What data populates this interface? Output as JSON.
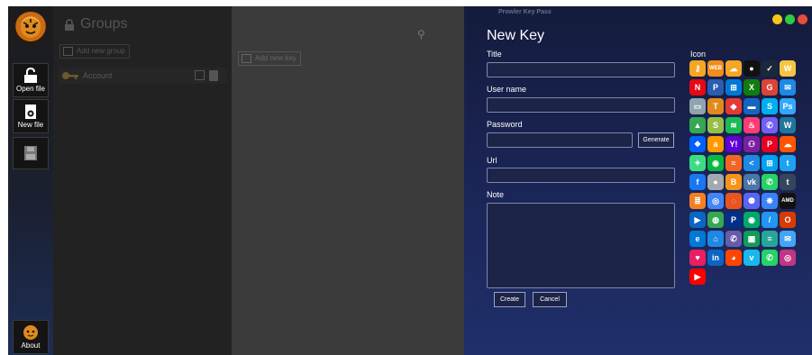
{
  "toolbar": {
    "open_file": "Open file",
    "new_file": "New file",
    "about": "About"
  },
  "groups": {
    "title": "Groups",
    "add_new_group": "Add new group",
    "items": [
      {
        "name": "Account"
      }
    ]
  },
  "keys": {
    "add_new_key": "Add new key"
  },
  "dialog": {
    "window_title": "Prowler Key Pass",
    "heading": "New Key",
    "fields": {
      "title_label": "Title",
      "title_value": "",
      "username_label": "User name",
      "username_value": "",
      "password_label": "Password",
      "password_value": "",
      "generate_button": "Generate",
      "url_label": "Url",
      "url_value": "",
      "note_label": "Note",
      "note_value": ""
    },
    "create_button": "Create",
    "cancel_button": "Cancel",
    "icon_label": "Icon",
    "traffic_colors": [
      "#f5c518",
      "#2ecc40",
      "#e74c3c"
    ],
    "icons": [
      {
        "name": "key-icon",
        "glyph": "⚷",
        "color": "#f5a623"
      },
      {
        "name": "web-icon",
        "glyph": "WEB",
        "color": "#f28c1b"
      },
      {
        "name": "cloud-icon",
        "glyph": "☁",
        "color": "#f5a623"
      },
      {
        "name": "user-icon",
        "glyph": "●",
        "color": "#111111"
      },
      {
        "name": "steam-icon",
        "glyph": "✓",
        "color": "#1b2838"
      },
      {
        "name": "w-icon",
        "glyph": "W",
        "color": "#f4c542"
      },
      {
        "name": "netflix-icon",
        "glyph": "N",
        "color": "#e50914"
      },
      {
        "name": "playstation-icon",
        "glyph": "P",
        "color": "#2a5db0"
      },
      {
        "name": "windows-icon",
        "glyph": "⊞",
        "color": "#0078d7"
      },
      {
        "name": "xbox-icon",
        "glyph": "X",
        "color": "#107c10"
      },
      {
        "name": "google-icon",
        "glyph": "G",
        "color": "#db4437"
      },
      {
        "name": "mail-icon",
        "glyph": "✉",
        "color": "#1e88e5"
      },
      {
        "name": "laptop-icon",
        "glyph": "▭",
        "color": "#90a4ae"
      },
      {
        "name": "tiger-icon",
        "glyph": "T",
        "color": "#e08a1e"
      },
      {
        "name": "diamond-icon",
        "glyph": "◆",
        "color": "#e53935"
      },
      {
        "name": "card-icon",
        "glyph": "▬",
        "color": "#1565c0"
      },
      {
        "name": "skype-icon",
        "glyph": "S",
        "color": "#00aff0"
      },
      {
        "name": "photoshop-icon",
        "glyph": "Ps",
        "color": "#31a8ff"
      },
      {
        "name": "drive-icon",
        "glyph": "▲",
        "color": "#34a853"
      },
      {
        "name": "shopify-icon",
        "glyph": "S",
        "color": "#96bf48"
      },
      {
        "name": "spotify-icon",
        "glyph": "≋",
        "color": "#1db954"
      },
      {
        "name": "tinder-icon",
        "glyph": "♨",
        "color": "#fe3c72"
      },
      {
        "name": "viber-icon",
        "glyph": "✆",
        "color": "#7360f2"
      },
      {
        "name": "wordpress-icon",
        "glyph": "W",
        "color": "#21759b"
      },
      {
        "name": "dropbox-icon",
        "glyph": "❖",
        "color": "#0061ff"
      },
      {
        "name": "amazon-icon",
        "glyph": "a",
        "color": "#ff9900"
      },
      {
        "name": "yahoo-icon",
        "glyph": "Y!",
        "color": "#6001d2"
      },
      {
        "name": "group-icon",
        "glyph": "⚇",
        "color": "#7b1fa2"
      },
      {
        "name": "pinterest-icon",
        "glyph": "P",
        "color": "#e60023"
      },
      {
        "name": "soundcloud-icon",
        "glyph": "☁",
        "color": "#ff5500"
      },
      {
        "name": "android-icon",
        "glyph": "✦",
        "color": "#3ddc84"
      },
      {
        "name": "wechat-icon",
        "glyph": "◉",
        "color": "#09b83e"
      },
      {
        "name": "rss-icon",
        "glyph": "≈",
        "color": "#f26522"
      },
      {
        "name": "share-icon",
        "glyph": "<",
        "color": "#1e88e5"
      },
      {
        "name": "windows-color-icon",
        "glyph": "⊞",
        "color": "#00a4ef"
      },
      {
        "name": "twitter-icon",
        "glyph": "t",
        "color": "#1da1f2"
      },
      {
        "name": "facebook-icon",
        "glyph": "f",
        "color": "#1877f2"
      },
      {
        "name": "apple-icon",
        "glyph": "●",
        "color": "#a3aaae"
      },
      {
        "name": "bitcoin-icon",
        "glyph": "B",
        "color": "#f7931a"
      },
      {
        "name": "vk-icon",
        "glyph": "vk",
        "color": "#4a76a8"
      },
      {
        "name": "whatsapp-icon",
        "glyph": "✆",
        "color": "#25d366"
      },
      {
        "name": "tumblr-icon",
        "glyph": "t",
        "color": "#35465c"
      },
      {
        "name": "stackoverflow-icon",
        "glyph": "≣",
        "color": "#f48024"
      },
      {
        "name": "chrome-icon",
        "glyph": "◎",
        "color": "#4285f4"
      },
      {
        "name": "ubuntu-icon",
        "glyph": "◌",
        "color": "#e95420"
      },
      {
        "name": "discord-icon",
        "glyph": "⚉",
        "color": "#5865f2"
      },
      {
        "name": "paw-icon",
        "glyph": "❋",
        "color": "#3b82f6"
      },
      {
        "name": "amd-icon",
        "glyph": "AMD",
        "color": "#111111"
      },
      {
        "name": "arrow-icon",
        "glyph": "▶",
        "color": "#0a66c2"
      },
      {
        "name": "chrome-alt-icon",
        "glyph": "◍",
        "color": "#34a853"
      },
      {
        "name": "paypal-icon",
        "glyph": "P",
        "color": "#003087"
      },
      {
        "name": "eye-icon",
        "glyph": "◉",
        "color": "#00a86b"
      },
      {
        "name": "slash-icon",
        "glyph": "/",
        "color": "#2196f3"
      },
      {
        "name": "office-icon",
        "glyph": "O",
        "color": "#d83b01"
      },
      {
        "name": "edge-icon",
        "glyph": "e",
        "color": "#0078d7"
      },
      {
        "name": "cap-icon",
        "glyph": "⌂",
        "color": "#1e88e5"
      },
      {
        "name": "viber-alt-icon",
        "glyph": "✆",
        "color": "#665cac"
      },
      {
        "name": "sheet-icon",
        "glyph": "▦",
        "color": "#0f9d58"
      },
      {
        "name": "layers-icon",
        "glyph": "≡",
        "color": "#26a69a"
      },
      {
        "name": "email-icon",
        "glyph": "✉",
        "color": "#42a5f5"
      },
      {
        "name": "heart-icon",
        "glyph": "♥",
        "color": "#e91e63"
      },
      {
        "name": "linkedin-icon",
        "glyph": "in",
        "color": "#0a66c2"
      },
      {
        "name": "reddit-icon",
        "glyph": "◕",
        "color": "#ff4500"
      },
      {
        "name": "vimeo-icon",
        "glyph": "v",
        "color": "#1ab7ea"
      },
      {
        "name": "whatsapp-alt-icon",
        "glyph": "✆",
        "color": "#25d366"
      },
      {
        "name": "instagram-icon",
        "glyph": "◎",
        "color": "#c13584"
      },
      {
        "name": "youtube-icon",
        "glyph": "▶",
        "color": "#ff0000"
      }
    ]
  }
}
